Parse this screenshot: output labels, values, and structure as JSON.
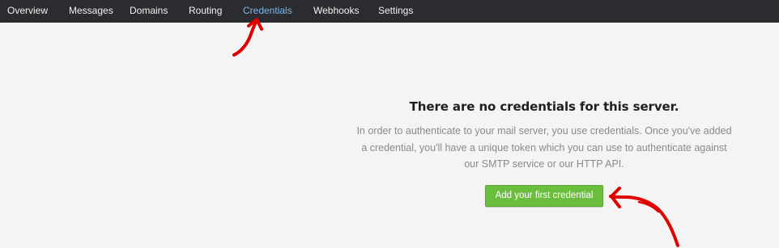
{
  "nav": {
    "items": [
      {
        "label": "Overview"
      },
      {
        "label": "Messages"
      },
      {
        "label": "Domains"
      },
      {
        "label": "Routing"
      },
      {
        "label": "Credentials",
        "active": true
      },
      {
        "label": "Webhooks"
      },
      {
        "label": "Settings"
      }
    ]
  },
  "empty_state": {
    "title": "There are no credentials for this server.",
    "description": "In order to authenticate to your mail server, you use credentials. Once you've added a credential, you'll have a unique token which you can use to authenticate against our SMTP service or our HTTP API.",
    "button_label": "Add your first credential"
  },
  "colors": {
    "nav_background": "#2b2c2f",
    "nav_active": "#7db6ec",
    "page_background": "#f4f4f4",
    "button_green": "#6bbd3e",
    "annotation_red": "#e00000"
  },
  "annotations": [
    {
      "name": "red-arrow-pointing-to-credentials-tab"
    },
    {
      "name": "red-arrow-pointing-to-add-credential-button"
    }
  ]
}
